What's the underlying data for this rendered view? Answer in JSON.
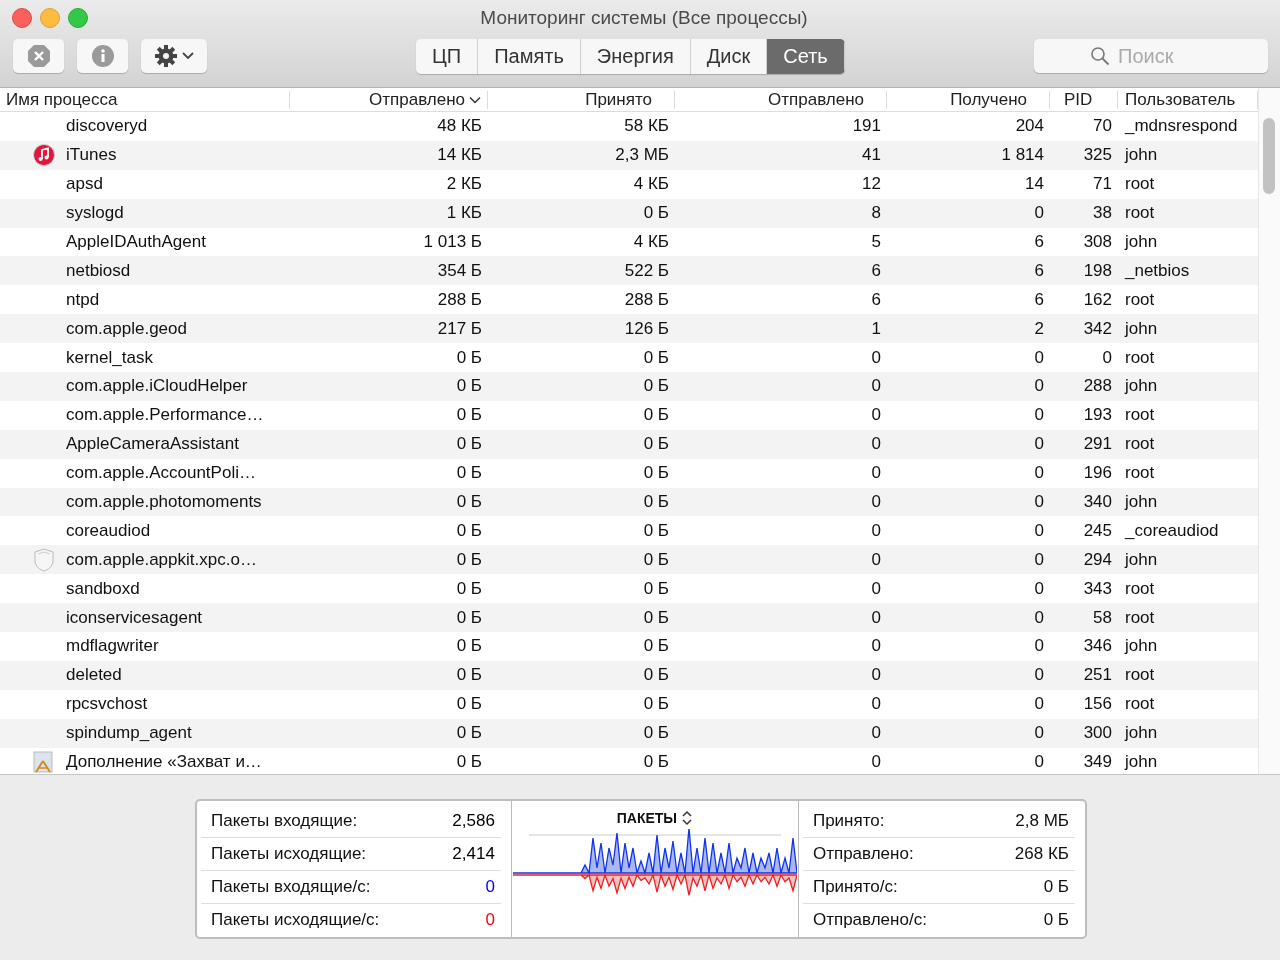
{
  "window": {
    "title": "Мониторинг системы (Все процессы)"
  },
  "tabs": [
    {
      "label": "ЦП",
      "selected": false
    },
    {
      "label": "Память",
      "selected": false
    },
    {
      "label": "Энергия",
      "selected": false
    },
    {
      "label": "Диск",
      "selected": false
    },
    {
      "label": "Сеть",
      "selected": true
    }
  ],
  "search": {
    "placeholder": "Поиск"
  },
  "table": {
    "columns": [
      {
        "label": "Имя процесса",
        "sorted": false
      },
      {
        "label": "Отправлено",
        "sorted": true
      },
      {
        "label": "Принято",
        "sorted": false
      },
      {
        "label": "Отправлено",
        "sorted": false
      },
      {
        "label": "Получено",
        "sorted": false
      },
      {
        "label": "PID",
        "sorted": false
      },
      {
        "label": "Пользователь",
        "sorted": false
      }
    ],
    "rows": [
      {
        "cells": [
          "discoveryd",
          "48 КБ",
          "58 КБ",
          "191",
          "204",
          "70",
          "_mdnsrespond"
        ]
      },
      {
        "kind": "music",
        "cells": [
          "iTunes",
          "14 КБ",
          "2,3 МБ",
          "41",
          "1 814",
          "325",
          "john"
        ]
      },
      {
        "cells": [
          "apsd",
          "2 КБ",
          "4 КБ",
          "12",
          "14",
          "71",
          "root"
        ]
      },
      {
        "cells": [
          "syslogd",
          "1 КБ",
          "0 Б",
          "8",
          "0",
          "38",
          "root"
        ]
      },
      {
        "cells": [
          "AppleIDAuthAgent",
          "1 013 Б",
          "4 КБ",
          "5",
          "6",
          "308",
          "john"
        ]
      },
      {
        "cells": [
          "netbiosd",
          "354 Б",
          "522 Б",
          "6",
          "6",
          "198",
          "_netbios"
        ]
      },
      {
        "cells": [
          "ntpd",
          "288 Б",
          "288 Б",
          "6",
          "6",
          "162",
          "root"
        ]
      },
      {
        "cells": [
          "com.apple.geod",
          "217 Б",
          "126 Б",
          "1",
          "2",
          "342",
          "john"
        ]
      },
      {
        "cells": [
          "kernel_task",
          "0 Б",
          "0 Б",
          "0",
          "0",
          "0",
          "root"
        ]
      },
      {
        "cells": [
          "com.apple.iCloudHelper",
          "0 Б",
          "0 Б",
          "0",
          "0",
          "288",
          "john"
        ]
      },
      {
        "cells": [
          "com.apple.Performance…",
          "0 Б",
          "0 Б",
          "0",
          "0",
          "193",
          "root"
        ]
      },
      {
        "cells": [
          "AppleCameraAssistant",
          "0 Б",
          "0 Б",
          "0",
          "0",
          "291",
          "root"
        ]
      },
      {
        "cells": [
          "com.apple.AccountPoli…",
          "0 Б",
          "0 Б",
          "0",
          "0",
          "196",
          "root"
        ]
      },
      {
        "cells": [
          "com.apple.photomoments",
          "0 Б",
          "0 Б",
          "0",
          "0",
          "340",
          "john"
        ]
      },
      {
        "cells": [
          "coreaudiod",
          "0 Б",
          "0 Б",
          "0",
          "0",
          "245",
          "_coreaudiod"
        ]
      },
      {
        "kind": "shield",
        "cells": [
          "com.apple.appkit.xpc.o…",
          "0 Б",
          "0 Б",
          "0",
          "0",
          "294",
          "john"
        ]
      },
      {
        "cells": [
          "sandboxd",
          "0 Б",
          "0 Б",
          "0",
          "0",
          "343",
          "root"
        ]
      },
      {
        "cells": [
          "iconservicesagent",
          "0 Б",
          "0 Б",
          "0",
          "0",
          "58",
          "root"
        ]
      },
      {
        "cells": [
          "mdflagwriter",
          "0 Б",
          "0 Б",
          "0",
          "0",
          "346",
          "john"
        ]
      },
      {
        "cells": [
          "deleted",
          "0 Б",
          "0 Б",
          "0",
          "0",
          "251",
          "root"
        ]
      },
      {
        "cells": [
          "rpcsvchost",
          "0 Б",
          "0 Б",
          "0",
          "0",
          "156",
          "root"
        ]
      },
      {
        "cells": [
          "spindump_agent",
          "0 Б",
          "0 Б",
          "0",
          "0",
          "300",
          "john"
        ]
      },
      {
        "kind": "app",
        "cells": [
          "Дополнение «Захват и…",
          "0 Б",
          "0 Б",
          "0",
          "0",
          "349",
          "john"
        ]
      }
    ]
  },
  "summary": {
    "left": [
      {
        "label": "Пакеты входящие:",
        "value": "2,586",
        "color": "#000000"
      },
      {
        "label": "Пакеты исходящие:",
        "value": "2,414",
        "color": "#000000"
      },
      {
        "label": "Пакеты входящие/с:",
        "value": "0",
        "color": "#0000ff"
      },
      {
        "label": "Пакеты исходящие/с:",
        "value": "0",
        "color": "#ff0000"
      }
    ],
    "graph": {
      "title": "ПАКЕТЫ"
    },
    "right": [
      {
        "label": "Принято:",
        "value": "2,8 МБ"
      },
      {
        "label": "Отправлено:",
        "value": "268 КБ"
      },
      {
        "label": "Принято/с:",
        "value": "0 Б"
      },
      {
        "label": "Отправлено/с:",
        "value": "0 Б"
      }
    ]
  }
}
